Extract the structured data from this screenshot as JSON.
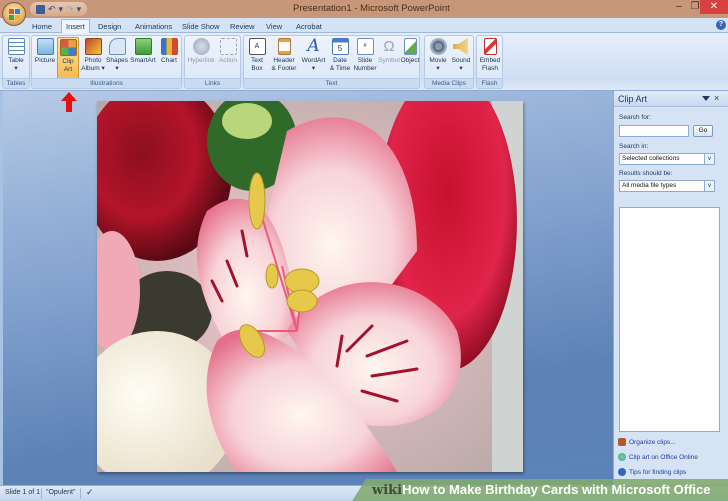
{
  "window": {
    "title": "Presentation1 - Microsoft PowerPoint",
    "controls": {
      "minimize": "–",
      "maximize": "❐",
      "close": "✕"
    }
  },
  "quick_access": {
    "undo": "↶",
    "dropdown": "▾",
    "redo": "↷",
    "customize": "▾"
  },
  "tabs": [
    {
      "label": "Home"
    },
    {
      "label": "Insert",
      "active": true
    },
    {
      "label": "Design"
    },
    {
      "label": "Animations"
    },
    {
      "label": "Slide Show"
    },
    {
      "label": "Review"
    },
    {
      "label": "View"
    },
    {
      "label": "Acrobat"
    }
  ],
  "help_icon": "?",
  "ribbon": {
    "groups": [
      {
        "label": "Tables",
        "buttons": [
          {
            "label1": "Table",
            "label2": "▾"
          }
        ]
      },
      {
        "label": "Illustrations",
        "buttons": [
          {
            "label1": "Picture",
            "label2": ""
          },
          {
            "label1": "Clip",
            "label2": "Art"
          },
          {
            "label1": "Photo",
            "label2": "Album ▾"
          },
          {
            "label1": "Shapes",
            "label2": "▾"
          },
          {
            "label1": "SmartArt",
            "label2": ""
          },
          {
            "label1": "Chart",
            "label2": ""
          }
        ]
      },
      {
        "label": "Links",
        "buttons": [
          {
            "label1": "Hyperlink",
            "label2": ""
          },
          {
            "label1": "Action",
            "label2": ""
          }
        ]
      },
      {
        "label": "Text",
        "buttons": [
          {
            "label1": "Text",
            "label2": "Box"
          },
          {
            "label1": "Header",
            "label2": "& Footer"
          },
          {
            "label1": "WordArt",
            "label2": "▾"
          },
          {
            "label1": "Date",
            "label2": "& Time"
          },
          {
            "label1": "Slide",
            "label2": "Number"
          },
          {
            "label1": "Symbol",
            "label2": ""
          },
          {
            "label1": "Object",
            "label2": ""
          }
        ]
      },
      {
        "label": "Media Clips",
        "buttons": [
          {
            "label1": "Movie",
            "label2": "▾"
          },
          {
            "label1": "Sound",
            "label2": "▾"
          }
        ]
      },
      {
        "label": "Flash",
        "buttons": [
          {
            "label1": "Embed",
            "label2": "Flash"
          }
        ]
      }
    ]
  },
  "clip_art_pane": {
    "title": "Clip Art",
    "close": "×",
    "search_for_label": "Search for:",
    "search_value": "",
    "go_label": "Go",
    "search_in_label": "Search in:",
    "search_in_value": "Selected collections",
    "results_label": "Results should be:",
    "results_value": "All media file types",
    "dropdown_glyph": "v",
    "links": [
      {
        "label": "Organize clips...",
        "color": "#b05a2a"
      },
      {
        "label": "Clip art on Office Online",
        "color": "#3aa0d8"
      },
      {
        "label": "Tips for finding clips",
        "color": "#3465b8"
      }
    ]
  },
  "slide": {
    "image_subject": "pink alstroemeria with red roses"
  },
  "status_bar": {
    "slide_info": "Slide 1 of 1",
    "theme": "\"Opulent\"",
    "spell_icon": "✓"
  },
  "watermark": {
    "wiki": "wiki",
    "text": "How to Make Birthday Cards with Microsoft Office"
  },
  "colors": {
    "title_bar": "#c8977a",
    "accent_arrow": "#e8100e",
    "ribbon_active": "#f8b94a",
    "close_button": "#d94141"
  }
}
